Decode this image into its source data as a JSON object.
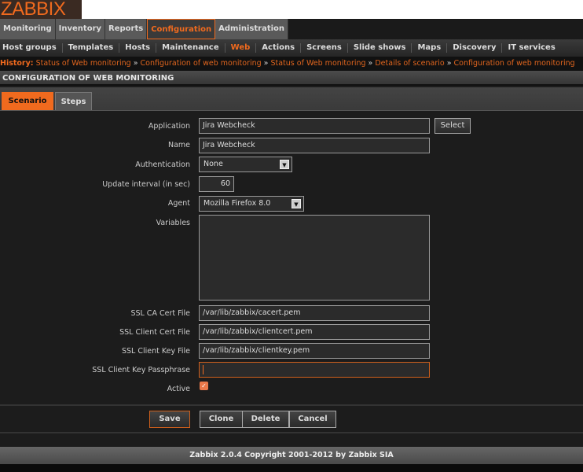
{
  "logo": "ZABBIX",
  "main_menu": [
    "Monitoring",
    "Inventory",
    "Reports",
    "Configuration",
    "Administration"
  ],
  "sub_menu": [
    "Host groups",
    "Templates",
    "Hosts",
    "Maintenance",
    "Web",
    "Actions",
    "Screens",
    "Slide shows",
    "Maps",
    "Discovery",
    "IT services"
  ],
  "history": {
    "label": "History:",
    "separator": "»",
    "items": [
      "Status of Web monitoring",
      "Configuration of web monitoring",
      "Status of Web monitoring",
      "Details of scenario",
      "Configuration of web monitoring"
    ]
  },
  "page_title": "CONFIGURATION OF WEB MONITORING",
  "tabs": [
    "Scenario",
    "Steps"
  ],
  "form": {
    "application": {
      "label": "Application",
      "value": "Jira Webcheck",
      "button": "Select"
    },
    "name": {
      "label": "Name",
      "value": "Jira Webcheck"
    },
    "authentication": {
      "label": "Authentication",
      "value": "None"
    },
    "update_interval": {
      "label": "Update interval (in sec)",
      "value": "60"
    },
    "agent": {
      "label": "Agent",
      "value": "Mozilla Firefox 8.0"
    },
    "variables": {
      "label": "Variables",
      "value": ""
    },
    "ssl_ca": {
      "label": "SSL CA Cert File",
      "value": "/var/lib/zabbix/cacert.pem"
    },
    "ssl_cert": {
      "label": "SSL Client Cert File",
      "value": "/var/lib/zabbix/clientcert.pem"
    },
    "ssl_key": {
      "label": "SSL Client Key File",
      "value": "/var/lib/zabbix/clientkey.pem"
    },
    "ssl_pass": {
      "label": "SSL Client Key Passphrase",
      "value": ""
    },
    "active": {
      "label": "Active",
      "checked": true
    }
  },
  "buttons": {
    "save": "Save",
    "clone": "Clone",
    "delete": "Delete",
    "cancel": "Cancel"
  },
  "footer": "Zabbix 2.0.4 Copyright 2001-2012 by Zabbix SIA",
  "colors": {
    "accent": "#f06a1e",
    "background": "#1c1c1c"
  }
}
